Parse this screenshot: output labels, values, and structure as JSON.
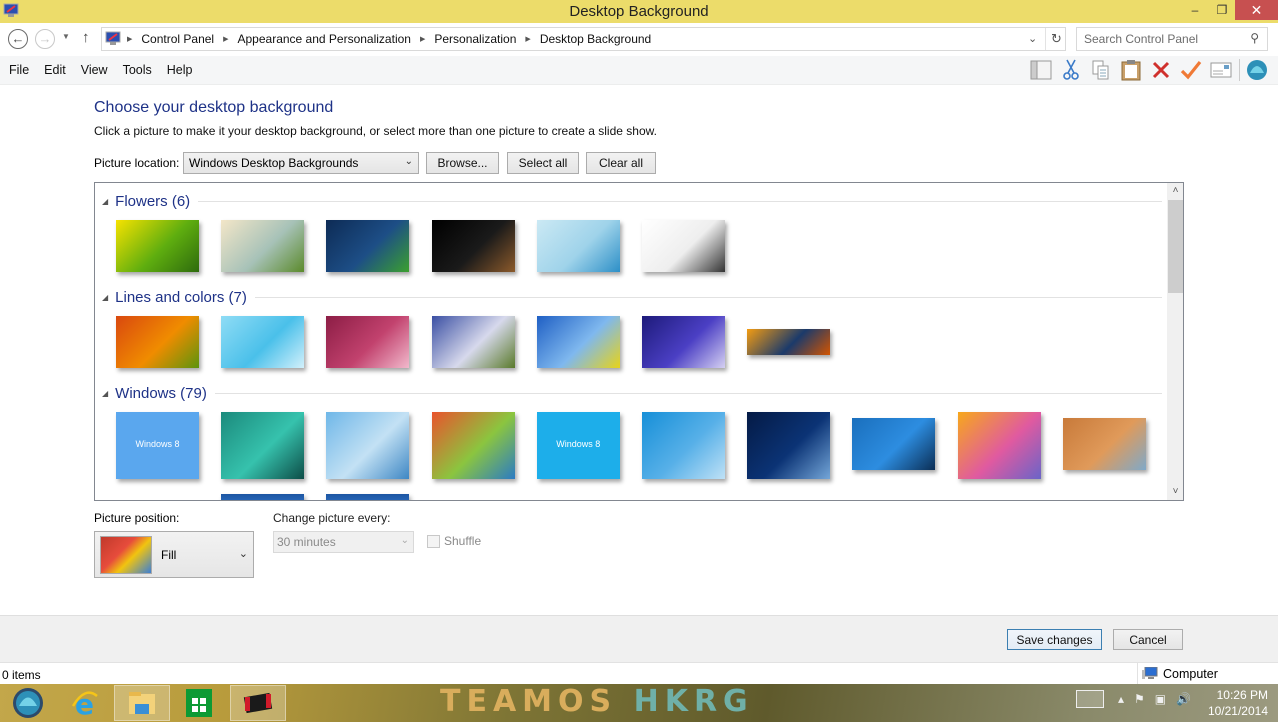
{
  "window": {
    "title": "Desktop Background",
    "minimize_glyph": "–",
    "maximize_glyph": "❐",
    "close_glyph": "✕"
  },
  "address_bar": {
    "breadcrumbs": [
      "Control Panel",
      "Appearance and Personalization",
      "Personalization",
      "Desktop Background"
    ],
    "search_placeholder": "Search Control Panel"
  },
  "menu": [
    "File",
    "Edit",
    "View",
    "Tools",
    "Help"
  ],
  "toolbar_icons": [
    "layout-pane-icon",
    "cut-icon",
    "copy-icon",
    "paste-icon",
    "delete-icon",
    "check-icon",
    "properties-icon",
    "shell-icon"
  ],
  "content": {
    "heading": "Choose your desktop background",
    "description": "Click a picture to make it your desktop background, or select more than one picture to create a slide show.",
    "picture_location_label": "Picture location:",
    "picture_location_value": "Windows Desktop Backgrounds",
    "browse_label": "Browse...",
    "select_all_label": "Select all",
    "clear_all_label": "Clear all"
  },
  "gallery": {
    "groups": [
      {
        "label": "Flowers (6)",
        "thumbnails": [
          {
            "desc": "green kiwi abstract",
            "colors": [
              "#f7e200",
              "#5fae0f",
              "#2e6b0d"
            ]
          },
          {
            "desc": "easter eggs in grass",
            "colors": [
              "#f3e6c8",
              "#a7c2b8",
              "#5b8a2b"
            ]
          },
          {
            "desc": "globe on dark blue",
            "colors": [
              "#0d2b55",
              "#1d4e86",
              "#3ba02f"
            ]
          },
          {
            "desc": "dark wooden blocks",
            "colors": [
              "#000000",
              "#1a1a1a",
              "#8c5a2b"
            ]
          },
          {
            "desc": "light blue snowflakes",
            "colors": [
              "#cbe9f4",
              "#9fd3ea",
              "#2d8fc7"
            ]
          },
          {
            "desc": "white sheep figures",
            "colors": [
              "#ffffff",
              "#eeeeee",
              "#333333"
            ]
          }
        ]
      },
      {
        "label": "Lines and colors (7)",
        "thumbnails": [
          {
            "desc": "autumn leaves",
            "colors": [
              "#d9480f",
              "#f08c00",
              "#5c940d"
            ]
          },
          {
            "desc": "aqua swirl",
            "colors": [
              "#8fdcf5",
              "#4ac0ea",
              "#d2f0fb"
            ]
          },
          {
            "desc": "magenta blossoms",
            "colors": [
              "#8c1d45",
              "#c2426e",
              "#f1b9cc"
            ]
          },
          {
            "desc": "mushroom field",
            "colors": [
              "#3a4fa3",
              "#d7d9ec",
              "#5a7a2a"
            ]
          },
          {
            "desc": "sunflower meadow sky",
            "colors": [
              "#1f5fc4",
              "#7fb8ee",
              "#e7d31a"
            ]
          },
          {
            "desc": "purple flowers",
            "colors": [
              "#1d1a7a",
              "#4b3fc4",
              "#d5d0f2"
            ]
          },
          {
            "desc": "orange bars",
            "colors": [
              "#f39c12",
              "#1b3a6b",
              "#d35400"
            ]
          }
        ]
      },
      {
        "label": "Windows (79)",
        "thumbnails": [
          {
            "desc": "Windows 8 blue",
            "caption": "Windows 8",
            "colors": [
              "#5aa7ee",
              "#5aa7ee",
              "#5aa7ee"
            ]
          },
          {
            "desc": "teal glass logo",
            "colors": [
              "#1b8a7c",
              "#36c2ad",
              "#0d4d47"
            ]
          },
          {
            "desc": "sky bridge",
            "colors": [
              "#6fb7e8",
              "#c3e1f4",
              "#3e87c4"
            ]
          },
          {
            "desc": "colored windows tiles",
            "colors": [
              "#e9532c",
              "#8bc53f",
              "#2b7bc4"
            ]
          },
          {
            "desc": "Windows 8 cyan",
            "caption": "Windows 8",
            "colors": [
              "#1daeea",
              "#1daeea",
              "#1daeea"
            ]
          },
          {
            "desc": "light blue gradient",
            "colors": [
              "#168fd8",
              "#57b0e8",
              "#bfe1f6"
            ]
          },
          {
            "desc": "dark blue light streaks",
            "colors": [
              "#041a45",
              "#0b3375",
              "#74a6d8"
            ]
          },
          {
            "desc": "blue window frame",
            "colors": [
              "#1a6fbd",
              "#2d8de0",
              "#0b2e55"
            ]
          },
          {
            "desc": "sunset waves",
            "colors": [
              "#f7a81b",
              "#e05aa0",
              "#6a64c8"
            ]
          },
          {
            "desc": "sandy beach",
            "colors": [
              "#c87a3a",
              "#e09a5a",
              "#7fa9c9"
            ]
          }
        ]
      }
    ]
  },
  "picture_position": {
    "label": "Picture position:",
    "value": "Fill"
  },
  "change_picture": {
    "label": "Change picture every:",
    "value": "30 minutes",
    "shuffle_label": "Shuffle",
    "shuffle_checked": false,
    "disabled": true
  },
  "footer": {
    "save_label": "Save changes",
    "cancel_label": "Cancel"
  },
  "statusbar": {
    "items_text": "0 items",
    "zone_label": "Computer"
  },
  "taskbar": {
    "apps": [
      "shell-start",
      "internet-explorer",
      "file-explorer",
      "windows-store",
      "media-app"
    ],
    "watermark_part1": "TEAMOS",
    "watermark_part2": "HKRG",
    "time": "10:26 PM",
    "date": "10/21/2014"
  }
}
